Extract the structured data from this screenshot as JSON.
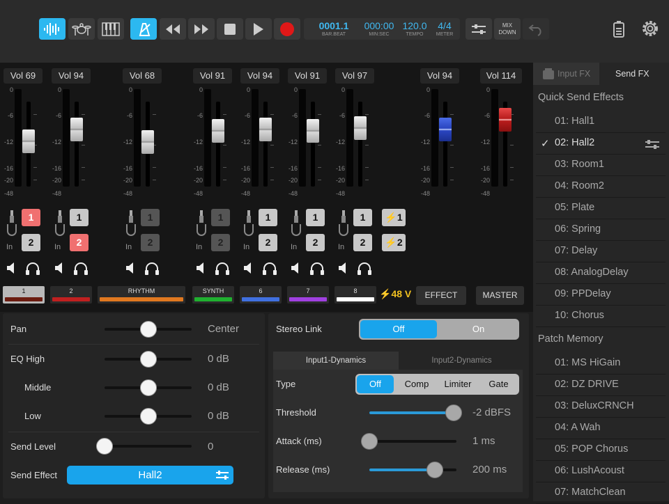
{
  "toolbar": {
    "counter": {
      "bar_beat": "0001.1",
      "bar_beat_label": "BAR.BEAT",
      "min_sec": "000:00",
      "min_sec_label": "MIN:SEC",
      "tempo": "120.0",
      "tempo_label": "TEMPO",
      "meter": "4/4",
      "meter_label": "METER"
    },
    "mixdown_line1": "MIX",
    "mixdown_line2": "DOWN",
    "accent_color": "#2cb8f0",
    "icons": [
      "waveform-icon",
      "drum-icon",
      "piano-icon",
      "metronome-icon",
      "rewind-icon",
      "fast-forward-icon",
      "stop-icon",
      "play-icon",
      "record-icon",
      "mixer-icon",
      "mixdown-icon",
      "undo-icon",
      "battery-icon",
      "gear-icon"
    ]
  },
  "mixer": {
    "channels": [
      {
        "vol_label": "Vol",
        "vol": "69",
        "name": "1",
        "color": "#6b1c10",
        "in1": "1",
        "in2": "2",
        "in1_state": "red",
        "in2_state": "normal",
        "selected": true
      },
      {
        "vol_label": "Vol",
        "vol": "94",
        "name": "2",
        "color": "#c02020",
        "in1": "1",
        "in2": "2",
        "in1_state": "normal",
        "in2_state": "red",
        "selected": false
      },
      {
        "vol_label": "Vol",
        "vol": "68",
        "name": "RHYTHM",
        "color": "#e07820",
        "in1": "1",
        "in2": "2",
        "in1_state": "dim",
        "in2_state": "dim",
        "selected": false
      },
      {
        "vol_label": "Vol",
        "vol": "91",
        "name": "SYNTH",
        "color": "#20b030",
        "in1": "1",
        "in2": "2",
        "in1_state": "dim",
        "in2_state": "dim",
        "selected": false
      },
      {
        "vol_label": "Vol",
        "vol": "94",
        "name": "6",
        "color": "#4070e0",
        "in1": "1",
        "in2": "2",
        "in1_state": "normal",
        "in2_state": "normal",
        "selected": false
      },
      {
        "vol_label": "Vol",
        "vol": "91",
        "name": "7",
        "color": "#a040e0",
        "in1": "1",
        "in2": "2",
        "in1_state": "normal",
        "in2_state": "normal",
        "selected": false
      },
      {
        "vol_label": "Vol",
        "vol": "97",
        "name": "8",
        "color": "#ffffff",
        "in1": "1",
        "in2": "2",
        "in1_state": "normal",
        "in2_state": "normal",
        "selected": false
      }
    ],
    "effect": {
      "vol_label": "Vol",
      "vol": "94",
      "name": "EFFECT"
    },
    "master": {
      "vol_label": "Vol",
      "vol": "114",
      "name": "MASTER"
    },
    "scale_ticks": [
      "0",
      "-6",
      "-12",
      "-16",
      "-20",
      "-48"
    ],
    "phantom": {
      "btn1": "1",
      "btn2": "2",
      "label": "48 V"
    },
    "in_label": "In"
  },
  "left_panel": {
    "pan": {
      "label": "Pan",
      "value": "Center",
      "level": 0.5
    },
    "eq_high": {
      "label": "EQ High",
      "value": "0 dB",
      "level": 0.5
    },
    "eq_mid": {
      "label": "Middle",
      "value": "0 dB",
      "level": 0.5
    },
    "eq_low": {
      "label": "Low",
      "value": "0 dB",
      "level": 0.5
    },
    "send_level": {
      "label": "Send Level",
      "value": "0",
      "level": 0.0
    },
    "send_effect": {
      "label": "Send Effect",
      "value": "Hall2"
    }
  },
  "right_panel": {
    "stereo_link": {
      "label": "Stereo Link",
      "off": "Off",
      "on": "On",
      "selected": "Off"
    },
    "tabs": [
      "Input1-Dynamics",
      "Input2-Dynamics"
    ],
    "type": {
      "label": "Type",
      "options": [
        "Off",
        "Comp",
        "Limiter",
        "Gate"
      ],
      "selected": "Off"
    },
    "threshold": {
      "label": "Threshold",
      "value": "-2 dBFS",
      "level": 0.97
    },
    "attack": {
      "label": "Attack (ms)",
      "value": "1 ms",
      "level": 0.0
    },
    "release": {
      "label": "Release (ms)",
      "value": "200 ms",
      "level": 0.75
    }
  },
  "fx_panel": {
    "tabs": [
      "Input FX",
      "Send FX"
    ],
    "active_tab": "Send FX",
    "quick_send_title": "Quick Send Effects",
    "quick_send": [
      "01: Hall1",
      "02: Hall2",
      "03: Room1",
      "04: Room2",
      "05: Plate",
      "06: Spring",
      "07: Delay",
      "08: AnalogDelay",
      "09: PPDelay",
      "10: Chorus"
    ],
    "selected": "02: Hall2",
    "patch_title": "Patch Memory",
    "patches": [
      "01: MS HiGain",
      "02: DZ DRIVE",
      "03: DeluxCRNCH",
      "04: A Wah",
      "05: POP Chorus",
      "06: LushAcoust",
      "07: MatchClean"
    ]
  }
}
